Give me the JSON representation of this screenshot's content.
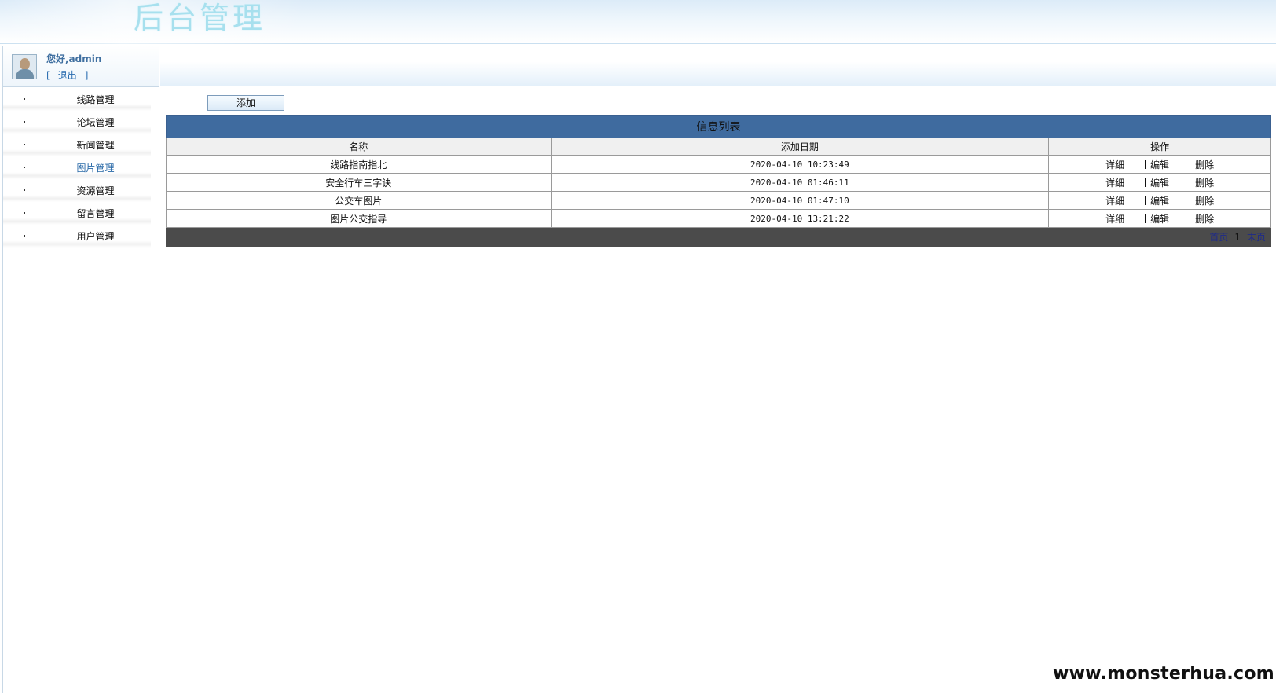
{
  "banner": {
    "title": "后台管理"
  },
  "user": {
    "greeting": "您好,admin",
    "bracket_open": "[",
    "logout_label": "退出",
    "bracket_close": "]",
    "avatar_icon": "user-avatar-icon"
  },
  "menu": {
    "items": [
      {
        "label": "线路管理",
        "active": false
      },
      {
        "label": "论坛管理",
        "active": false
      },
      {
        "label": "新闻管理",
        "active": false
      },
      {
        "label": "图片管理",
        "active": true
      },
      {
        "label": "资源管理",
        "active": false
      },
      {
        "label": "留言管理",
        "active": false
      },
      {
        "label": "用户管理",
        "active": false
      }
    ]
  },
  "toolbar": {
    "add_label": "添加"
  },
  "table": {
    "caption": "信息列表",
    "columns": [
      "名称",
      "添加日期",
      "操作"
    ],
    "rows": [
      {
        "name": "线路指南指北",
        "date": "2020-04-10 10:23:49"
      },
      {
        "name": "安全行车三字诀",
        "date": "2020-04-10 01:46:11"
      },
      {
        "name": "公交车图片",
        "date": "2020-04-10 01:47:10"
      },
      {
        "name": "图片公交指导",
        "date": "2020-04-10 13:21:22"
      }
    ],
    "actions": {
      "detail": "详细",
      "edit": "编辑",
      "delete": "删除"
    }
  },
  "pager": {
    "first": "首页",
    "current": "1",
    "last": "末页"
  },
  "watermark": "www.monsterhua.com",
  "colors": {
    "table_caption_bg": "#3f6b9f",
    "pager_bg": "#4b4b4b",
    "active_menu": "#2a6aa8",
    "banner_title": "#a7e0ee"
  }
}
